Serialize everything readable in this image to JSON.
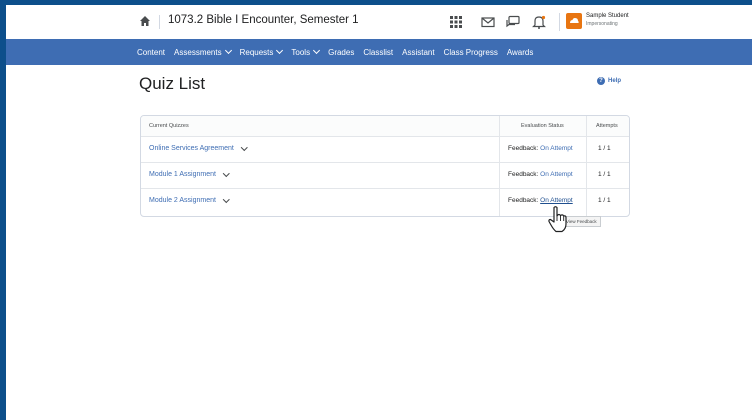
{
  "header": {
    "course_title": "1073.2 Bible I Encounter, Semester 1",
    "user_name": "Sample Student",
    "user_role": "Impersonating"
  },
  "nav": {
    "items": [
      {
        "label": "Content",
        "dropdown": false
      },
      {
        "label": "Assessments",
        "dropdown": true
      },
      {
        "label": "Requests",
        "dropdown": true
      },
      {
        "label": "Tools",
        "dropdown": true
      },
      {
        "label": "Grades",
        "dropdown": false
      },
      {
        "label": "Classlist",
        "dropdown": false
      },
      {
        "label": "Assistant",
        "dropdown": false
      },
      {
        "label": "Class Progress",
        "dropdown": false
      },
      {
        "label": "Awards",
        "dropdown": false
      }
    ]
  },
  "page": {
    "title": "Quiz List",
    "help_label": "Help"
  },
  "table": {
    "columns": [
      "Current Quizzes",
      "Evaluation Status",
      "Attempts"
    ],
    "rows": [
      {
        "quiz": "Online Services Agreement",
        "feedback_prefix": "Feedback:",
        "feedback_link": "On Attempt",
        "attempts": "1 / 1"
      },
      {
        "quiz": "Module 1 Assignment",
        "feedback_prefix": "Feedback:",
        "feedback_link": "On Attempt",
        "attempts": "1 / 1"
      },
      {
        "quiz": "Module 2 Assignment",
        "feedback_prefix": "Feedback:",
        "feedback_link": "On Attempt",
        "attempts": "1 / 1"
      }
    ]
  },
  "tooltip": {
    "text": "View Feedback"
  },
  "colors": {
    "outer_border": "#0d4f8b",
    "nav_background": "#3e6db3",
    "link": "#3e6db3",
    "avatar": "#e87511"
  },
  "icons": [
    "home-icon",
    "waffle-grid-icon",
    "mail-icon",
    "chat-icon",
    "bell-icon",
    "help-icon",
    "chevron-down-icon",
    "hand-cursor-icon"
  ]
}
